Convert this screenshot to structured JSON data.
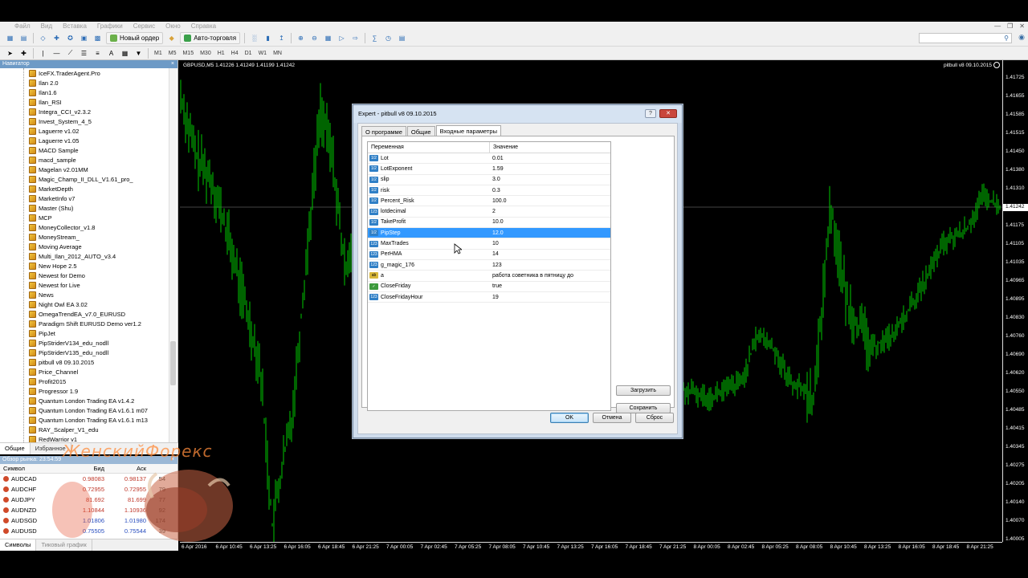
{
  "menu": [
    "Файл",
    "Вид",
    "Вставка",
    "Графики",
    "Сервис",
    "Окно",
    "Справка"
  ],
  "toolbar": {
    "new_order": "Новый ордер",
    "autotrading": "Авто-торговля",
    "search_icon": "search-icon"
  },
  "timeframes": [
    "M1",
    "M5",
    "M15",
    "M30",
    "H1",
    "H4",
    "D1",
    "W1",
    "MN"
  ],
  "navigator": {
    "title": "Навигатор",
    "items": [
      "IceFX.TraderAgent.Pro",
      "Ilan 2.0",
      "Ilan1.6",
      "Ilan_RSI",
      "Integra_CCI_v2.3.2",
      "Invest_System_4_5",
      "Laguerre v1.02",
      "Laguerre v1.05",
      "MACD Sample",
      "macd_sample",
      "Magelan v2.01MM",
      "Magic_Champ_II_DLL_V1.61_pro_",
      "MarketDepth",
      "MarketInfo v7",
      "Master (Shu)",
      "MCP",
      "MoneyCollector_v1.8",
      "MoneyStream_",
      "Moving Average",
      "Multi_Ilan_2012_AUTO_v3.4",
      "New Hope 2.5",
      "Newest for Demo",
      "Newest for Live",
      "News",
      "Night Owl EA 3.02",
      "OmegaTrendEA_v7.0_EURUSD",
      "Paradigm Shift EURUSD Demo ver1.2",
      "PipJet",
      "PipStriderV134_edu_nodll",
      "PipStriderV135_edu_nodll",
      "pitbull v8 09.10.2015",
      "Price_Channel",
      "Profit2015",
      "Progressor 1.9",
      "Quantum London Trading EA v1.4.2",
      "Quantum London Trading EA v1.6.1 m07",
      "Quantum London Trading EA v1.6.1 m13",
      "RAY_Scalper_V1_edu",
      "RedWarrior v1"
    ],
    "tabs": [
      "Общие",
      "Избранное"
    ]
  },
  "market_watch": {
    "title": "Обзор рынка: 23:54:59",
    "headers": [
      "Символ",
      "Бид",
      "Аск",
      ""
    ],
    "rows": [
      {
        "symbol": "AUDCAD",
        "bid": "0.98083",
        "ask": "0.98137",
        "spread": "54"
      },
      {
        "symbol": "AUDCHF",
        "bid": "0.72955",
        "ask": "0.72955",
        "spread": "79"
      },
      {
        "symbol": "AUDJPY",
        "bid": "81.692",
        "ask": "81.699",
        "spread": "77"
      },
      {
        "symbol": "AUDNZD",
        "bid": "1.10844",
        "ask": "1.10936",
        "spread": "92"
      },
      {
        "symbol": "AUDSGD",
        "bid": "1.01806",
        "ask": "1.01980",
        "spread": "174"
      },
      {
        "symbol": "AUDUSD",
        "bid": "0.75505",
        "ask": "0.75544",
        "spread": "39"
      }
    ],
    "tabs": [
      "Символы",
      "Тиковый график"
    ]
  },
  "watermark": "ЖенскийФорекс",
  "chart": {
    "info": "GBPUSD,M5  1.41226 1.41249 1.41199 1.41242",
    "ea_label": "pitbull v8 09.10.2015",
    "prices": [
      "1.41725",
      "1.41655",
      "1.41585",
      "1.41515",
      "1.41450",
      "1.41380",
      "1.41310",
      "1.41242",
      "1.41175",
      "1.41105",
      "1.41035",
      "1.40965",
      "1.40895",
      "1.40830",
      "1.40760",
      "1.40690",
      "1.40620",
      "1.40550",
      "1.40485",
      "1.40415",
      "1.40345",
      "1.40275",
      "1.40205",
      "1.40140",
      "1.40070",
      "1.40005"
    ],
    "current_price": "1.41242",
    "times": [
      "6 Apr 2016",
      "6 Apr 10:45",
      "6 Apr 13:25",
      "6 Apr 16:05",
      "6 Apr 18:45",
      "6 Apr 21:25",
      "7 Apr 00:05",
      "7 Apr 02:45",
      "7 Apr 05:25",
      "7 Apr 08:05",
      "7 Apr 10:45",
      "7 Apr 13:25",
      "7 Apr 16:05",
      "7 Apr 18:45",
      "7 Apr 21:25",
      "8 Apr 00:05",
      "8 Apr 02:45",
      "8 Apr 05:25",
      "8 Apr 08:05",
      "8 Apr 10:45",
      "8 Apr 13:25",
      "8 Apr 16:05",
      "8 Apr 18:45",
      "8 Apr 21:25"
    ],
    "candle_color": "#00c800"
  },
  "dialog": {
    "title": "Expert - pitbull v8 09.10.2015",
    "tabs": [
      "О программе",
      "Общие",
      "Входные параметры"
    ],
    "col_variable": "Переменная",
    "col_value": "Значение",
    "params": [
      {
        "name": "Lot",
        "value": "0.01",
        "type": "v12"
      },
      {
        "name": "LotExponent",
        "value": "1.59",
        "type": "v12"
      },
      {
        "name": "slip",
        "value": "3.0",
        "type": "v12"
      },
      {
        "name": "risk",
        "value": "0.3",
        "type": "v12"
      },
      {
        "name": "Percent_Risk",
        "value": "100.0",
        "type": "v12"
      },
      {
        "name": "lotdecimal",
        "value": "2",
        "type": "int"
      },
      {
        "name": "TakeProfit",
        "value": "10.0",
        "type": "v12"
      },
      {
        "name": "PipStep",
        "value": "12.0",
        "type": "v12",
        "selected": true
      },
      {
        "name": "MaxTrades",
        "value": "10",
        "type": "int"
      },
      {
        "name": "PerHMA",
        "value": "14",
        "type": "int"
      },
      {
        "name": "g_magic_176",
        "value": "123",
        "type": "int"
      },
      {
        "name": "a",
        "value": "работа советника в пятницу до",
        "type": "ab"
      },
      {
        "name": "CloseFriday",
        "value": "true",
        "type": "bool"
      },
      {
        "name": "CloseFridayHour",
        "value": "19",
        "type": "int"
      }
    ],
    "load": "Загрузить",
    "save": "Сохранить",
    "ok": "OK",
    "cancel": "Отмена",
    "reset": "Сброс"
  }
}
